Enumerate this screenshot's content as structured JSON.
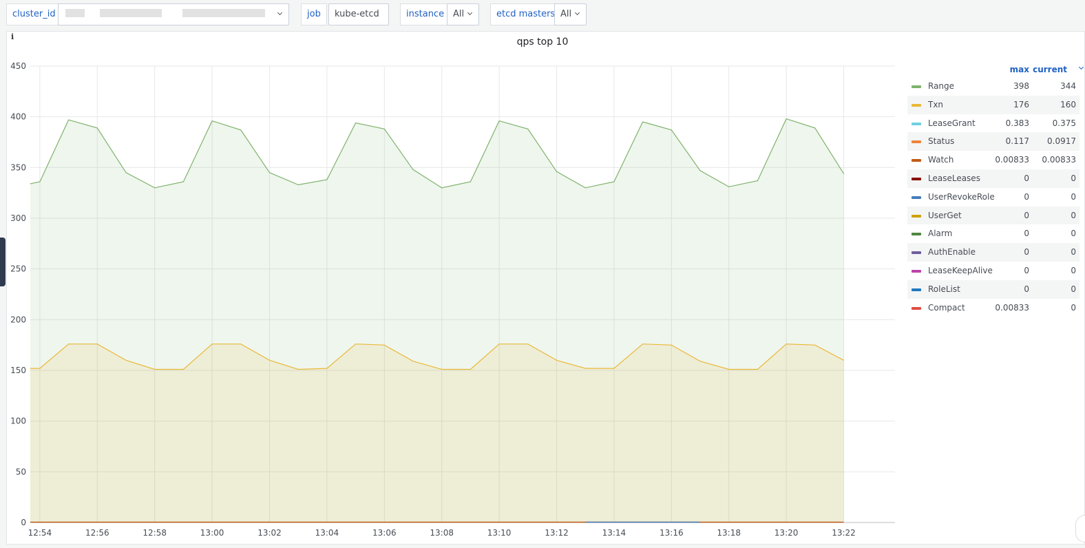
{
  "variables": [
    {
      "label": "cluster_id",
      "value": "",
      "obscured": true
    },
    {
      "label": "job",
      "value": "kube-etcd"
    },
    {
      "label": "instance",
      "value": "All"
    },
    {
      "label": "etcd masters",
      "value": "All"
    }
  ],
  "panel": {
    "title": "qps top 10",
    "info_icon": "i"
  },
  "legend": {
    "col_max": "max",
    "col_current": "current",
    "items": [
      {
        "name": "Range",
        "max": "398",
        "current": "344",
        "color": "#7eb26d"
      },
      {
        "name": "Txn",
        "max": "176",
        "current": "160",
        "color": "#eab839"
      },
      {
        "name": "LeaseGrant",
        "max": "0.383",
        "current": "0.375",
        "color": "#6ed0e0"
      },
      {
        "name": "Status",
        "max": "0.117",
        "current": "0.0917",
        "color": "#ef843c"
      },
      {
        "name": "Watch",
        "max": "0.00833",
        "current": "0.00833",
        "color": "#c15c17"
      },
      {
        "name": "LeaseLeases",
        "max": "0",
        "current": "0",
        "color": "#890f02"
      },
      {
        "name": "UserRevokeRole",
        "max": "0",
        "current": "0",
        "color": "#447ebc"
      },
      {
        "name": "UserGet",
        "max": "0",
        "current": "0",
        "color": "#cca300"
      },
      {
        "name": "Alarm",
        "max": "0",
        "current": "0",
        "color": "#508642"
      },
      {
        "name": "AuthEnable",
        "max": "0",
        "current": "0",
        "color": "#705da0"
      },
      {
        "name": "LeaseKeepAlive",
        "max": "0",
        "current": "0",
        "color": "#ba43a9"
      },
      {
        "name": "RoleList",
        "max": "0",
        "current": "0",
        "color": "#1f78c1"
      },
      {
        "name": "Compact",
        "max": "0.00833",
        "current": "0",
        "color": "#e24d42"
      }
    ]
  },
  "chart_data": {
    "type": "area",
    "title": "qps top 10",
    "ylim": [
      0,
      450
    ],
    "y_ticks": [
      0,
      50,
      100,
      150,
      200,
      250,
      300,
      350,
      400,
      450
    ],
    "x_tick_labels": [
      "12:54",
      "12:56",
      "12:58",
      "13:00",
      "13:02",
      "13:04",
      "13:06",
      "13:08",
      "13:10",
      "13:12",
      "13:14",
      "13:16",
      "13:18",
      "13:20",
      "13:22"
    ],
    "x": [
      "12:53:40",
      "12:54",
      "12:55",
      "12:56",
      "12:57",
      "12:58",
      "12:59",
      "13:00",
      "13:01",
      "13:02",
      "13:03",
      "13:04",
      "13:05",
      "13:06",
      "13:07",
      "13:08",
      "13:09",
      "13:10",
      "13:11",
      "13:12",
      "13:13",
      "13:14",
      "13:15",
      "13:16",
      "13:17",
      "13:18",
      "13:19",
      "13:20",
      "13:21",
      "13:22"
    ],
    "grid": true,
    "legend_position": "right",
    "series": [
      {
        "name": "Range",
        "color": "#7eb26d",
        "fill": true,
        "values": [
          334,
          336,
          397,
          389,
          345,
          330,
          336,
          396,
          387,
          345,
          333,
          338,
          394,
          388,
          348,
          330,
          336,
          396,
          388,
          346,
          330,
          336,
          395,
          387,
          347,
          331,
          337,
          398,
          389,
          344
        ]
      },
      {
        "name": "Txn",
        "color": "#eab839",
        "fill": true,
        "values": [
          152,
          152,
          176,
          176,
          160,
          151,
          151,
          176,
          176,
          160,
          151,
          152,
          176,
          175,
          159,
          151,
          151,
          176,
          176,
          160,
          152,
          152,
          176,
          175,
          159,
          151,
          151,
          176,
          175,
          160
        ]
      }
    ]
  }
}
